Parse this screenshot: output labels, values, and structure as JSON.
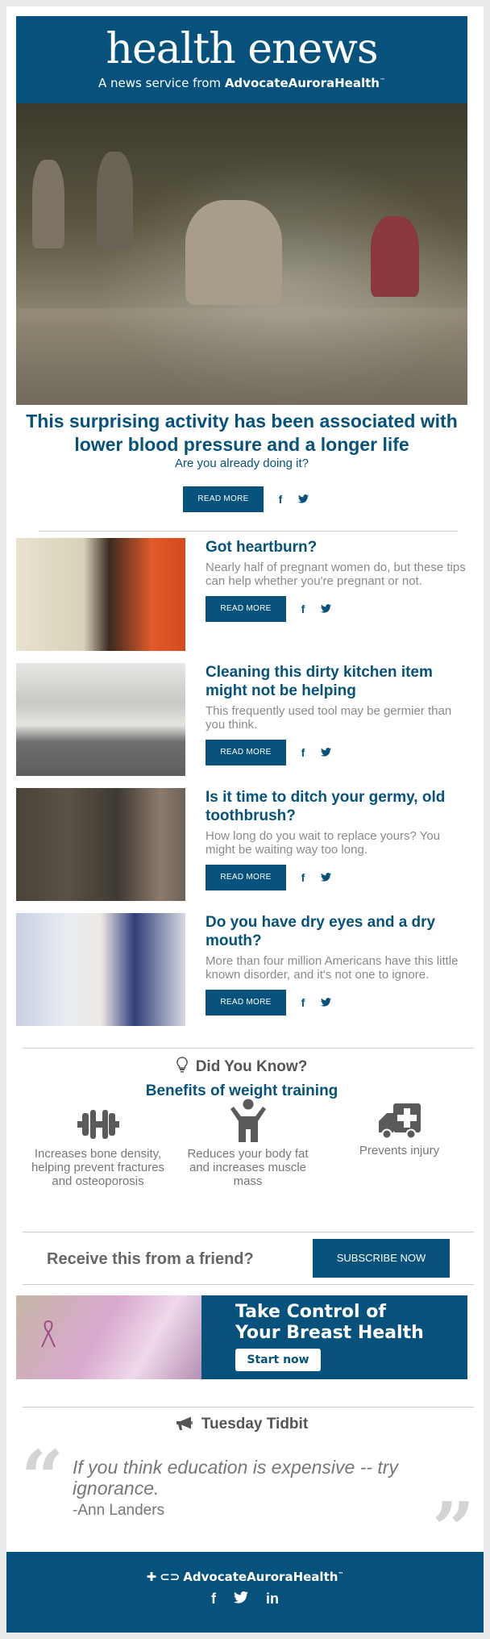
{
  "header": {
    "title": "health enews",
    "subtitle_prefix": "A news service from",
    "subtitle_brand": "AdvocateAuroraHealth",
    "trademark": "™"
  },
  "colors": {
    "brand": "#06527c",
    "muted_text": "#8a8a8a",
    "heading_gray": "#555555"
  },
  "hero": {
    "image": "people-picking-up-litter-photo",
    "title": "This surprising activity has been associated with lower blood pressure and a longer life",
    "subtitle": "Are you already doing it?",
    "read_more": "READ MORE",
    "icons": [
      "facebook-icon",
      "twitter-icon"
    ]
  },
  "articles": [
    {
      "image": "woman-heartburn-photo",
      "title": "Got heartburn?",
      "summary": "Nearly half of pregnant women do, but these tips can help whether you're pregnant or not.",
      "read_more": "READ MORE"
    },
    {
      "image": "kitchen-photo",
      "title": "Cleaning this dirty kitchen item might not be helping",
      "summary": "This frequently used tool may be germier than you think.",
      "read_more": "READ MORE"
    },
    {
      "image": "man-brushing-teeth-photo",
      "title": "Is it time to ditch your germy, old toothbrush?",
      "summary": "How long do you wait to replace yours? You might be waiting way too long.",
      "read_more": "READ MORE"
    },
    {
      "image": "doctor-patient-photo",
      "title": "Do you have dry eyes and a dry mouth?",
      "summary": "More than four million Americans have this little known disorder, and it's not one to ignore.",
      "read_more": "READ MORE"
    }
  ],
  "social": {
    "facebook": "f",
    "twitter": "🐦",
    "linkedin": "in"
  },
  "did_you_know": {
    "heading": "Did You Know?",
    "subheading": "Benefits of weight training",
    "benefits": [
      {
        "icon": "dumbbell-icon",
        "text": "Increases bone density, helping prevent fractures and osteoporosis"
      },
      {
        "icon": "person-icon",
        "text": "Reduces your body fat and increases muscle mass"
      },
      {
        "icon": "ambulance-icon",
        "text": "Prevents injury"
      }
    ]
  },
  "subscribe": {
    "question": "Receive this from a friend?",
    "button": "SUBSCRIBE NOW"
  },
  "ad": {
    "line1": "Take Control of",
    "line2": "Your Breast Health",
    "button": "Start now"
  },
  "tidbit": {
    "heading": "Tuesday Tidbit",
    "quote": "If you think education is expensive -- try ignorance.",
    "author": "-Ann Landers",
    "open_mark": "“",
    "close_mark": "”"
  },
  "footer": {
    "brand": "AdvocateAuroraHealth",
    "trademark": "™"
  }
}
